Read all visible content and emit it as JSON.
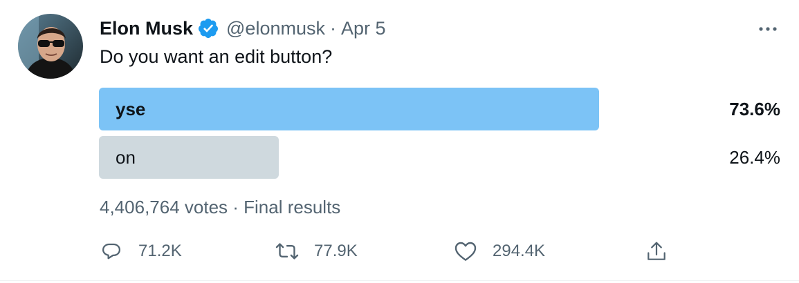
{
  "author": {
    "name": "Elon Musk",
    "handle": "@elonmusk",
    "separator": "·",
    "date": "Apr 5"
  },
  "tweet": {
    "text": "Do you want an edit button?"
  },
  "poll": {
    "options": [
      {
        "label": "yse",
        "percent_text": "73.6%",
        "percent": 73.6,
        "winner": true
      },
      {
        "label": "on",
        "percent_text": "26.4%",
        "percent": 26.4,
        "winner": false
      }
    ],
    "summary": "4,406,764 votes · Final results"
  },
  "actions": {
    "reply_count": "71.2K",
    "retweet_count": "77.9K",
    "like_count": "294.4K"
  },
  "colors": {
    "winner_bar": "#7cc3f6",
    "loser_bar": "#cfd9de",
    "verified_badge": "#1d9bf0",
    "secondary_text": "#536471"
  },
  "icons": [
    "verified-badge-icon",
    "more-icon",
    "reply-icon",
    "retweet-icon",
    "like-icon",
    "share-icon"
  ]
}
